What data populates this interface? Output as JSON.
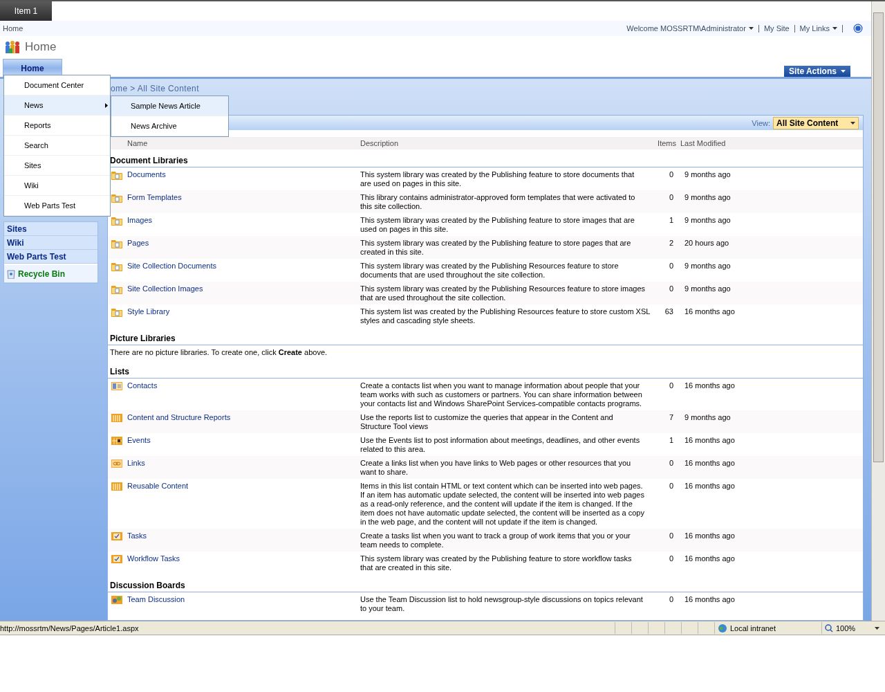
{
  "top_tabs": [
    {
      "label": "Item 1",
      "selected": true
    }
  ],
  "global_bar": {
    "breadcrumb": "Home",
    "welcome": "Welcome MOSSRTM\\Administrator",
    "links": [
      {
        "label": "My Site",
        "dropdown": false
      },
      {
        "label": "My Links",
        "dropdown": true
      }
    ]
  },
  "site_title": "Home",
  "nav_tabs": [
    {
      "label": "Home",
      "selected": true
    }
  ],
  "site_actions": "Site Actions",
  "breadcrumb": "ome > All Site Content",
  "menu": {
    "items": [
      {
        "label": "Document Center",
        "selected": false,
        "submenu": false
      },
      {
        "label": "News",
        "selected": true,
        "submenu": true
      },
      {
        "label": "Reports",
        "selected": false,
        "submenu": false
      },
      {
        "label": "Search",
        "selected": false,
        "submenu": false
      },
      {
        "label": "Sites",
        "selected": false,
        "submenu": false
      },
      {
        "label": "Wiki",
        "selected": false,
        "submenu": false
      },
      {
        "label": "Web Parts Test",
        "selected": false,
        "submenu": false
      }
    ],
    "submenu": [
      {
        "label": "Sample News Article",
        "selected": true
      },
      {
        "label": "News Archive",
        "selected": false
      }
    ]
  },
  "sidebar": {
    "items": [
      {
        "label": "Sites",
        "kind": "link"
      },
      {
        "label": "Wiki",
        "kind": "link"
      },
      {
        "label": "Web Parts Test",
        "kind": "link"
      },
      {
        "label": "Recycle Bin",
        "kind": "recycle"
      }
    ]
  },
  "view": {
    "label": "View:",
    "value": "All Site Content"
  },
  "table": {
    "columns": [
      "Name",
      "Description",
      "Items",
      "Last Modified"
    ],
    "sections": [
      {
        "title": "Document Libraries",
        "rows": [
          {
            "kind": "library",
            "name": "Documents",
            "description": [
              "This system library was created by the Publishing feature to store documents that",
              "are used on pages in this site."
            ],
            "items": "0",
            "modified": "9 months ago"
          },
          {
            "kind": "library",
            "name": "Form Templates",
            "description": [
              "This library contains administrator-approved form templates that were activated to",
              "this site collection."
            ],
            "items": "0",
            "modified": "9 months ago"
          },
          {
            "kind": "library",
            "name": "Images",
            "description": [
              "This system library was created by the Publishing feature to store images that are",
              "used on pages in this site."
            ],
            "items": "1",
            "modified": "9 months ago"
          },
          {
            "kind": "library",
            "name": "Pages",
            "description": [
              "This system library was created by the Publishing feature to store pages that are",
              "created in this site."
            ],
            "items": "2",
            "modified": "20 hours ago"
          },
          {
            "kind": "library",
            "name": "Site Collection Documents",
            "description": [
              "This system library was created by the Publishing Resources feature to store",
              "documents that are used throughout the site collection."
            ],
            "items": "0",
            "modified": "9 months ago"
          },
          {
            "kind": "library",
            "name": "Site Collection Images",
            "description": [
              "This system library was created by the Publishing Resources feature to store images",
              "that are used throughout the site collection."
            ],
            "items": "0",
            "modified": "9 months ago"
          },
          {
            "kind": "library",
            "name": "Style Library",
            "description": [
              "This system list was created by the Publishing Resources feature to store custom XSL",
              "styles and cascading style sheets."
            ],
            "items": "63",
            "modified": "16 months ago"
          }
        ]
      },
      {
        "title": "Picture Libraries",
        "empty_message": "There are no picture libraries. To create one, click **Create** above."
      },
      {
        "title": "Lists",
        "rows": [
          {
            "kind": "contacts",
            "name": "Contacts",
            "description": [
              "Create a contacts list when you want to manage information about people that your",
              "team works with such as customers or partners. You can share information between",
              "your contacts list and Windows SharePoint Services-compatible contacts programs."
            ],
            "items": "0",
            "modified": "16 months ago"
          },
          {
            "kind": "list",
            "name": "Content and Structure Reports",
            "description": [
              "Use the reports list to customize the queries that appear in the Content and",
              "Structure Tool views"
            ],
            "items": "7",
            "modified": "9 months ago"
          },
          {
            "kind": "events",
            "name": "Events",
            "description": [
              "Use the Events list to post information about meetings, deadlines, and other events",
              "related to this area."
            ],
            "items": "1",
            "modified": "16 months ago"
          },
          {
            "kind": "links",
            "name": "Links",
            "description": [
              "Create a links list when you have links to Web pages or other resources that you",
              "want to share."
            ],
            "items": "0",
            "modified": "16 months ago"
          },
          {
            "kind": "list",
            "name": "Reusable Content",
            "description": [
              "Items in this list contain HTML or text content which can be inserted into web pages.",
              "If an item has automatic update selected, the content will be inserted into web pages",
              "as a read-only reference, and the content will update if the item is changed. If the",
              "item does not have automatic update selected, the content will be inserted as a copy",
              "in the web page, and the content will not update if the item is changed."
            ],
            "items": "0",
            "modified": "16 months ago"
          },
          {
            "kind": "tasks",
            "name": "Tasks",
            "description": [
              "Create a tasks list when you want to track a group of work items that you or your",
              "team needs to complete."
            ],
            "items": "0",
            "modified": "16 months ago"
          },
          {
            "kind": "tasks",
            "name": "Workflow Tasks",
            "description": [
              "This system library was created by the Publishing feature to store workflow tasks",
              "that are created in this site."
            ],
            "items": "0",
            "modified": "16 months ago"
          }
        ]
      },
      {
        "title": "Discussion Boards",
        "rows": [
          {
            "kind": "discussion",
            "name": "Team Discussion",
            "description": [
              "Use the Team Discussion list to hold newsgroup-style discussions on topics relevant",
              "to your team."
            ],
            "items": "0",
            "modified": "16 months ago"
          }
        ]
      }
    ]
  },
  "status_bar": {
    "url": "http://mossrtm/News/Pages/Article1.aspx",
    "zone": "Local intranet",
    "zoom": "100%"
  }
}
